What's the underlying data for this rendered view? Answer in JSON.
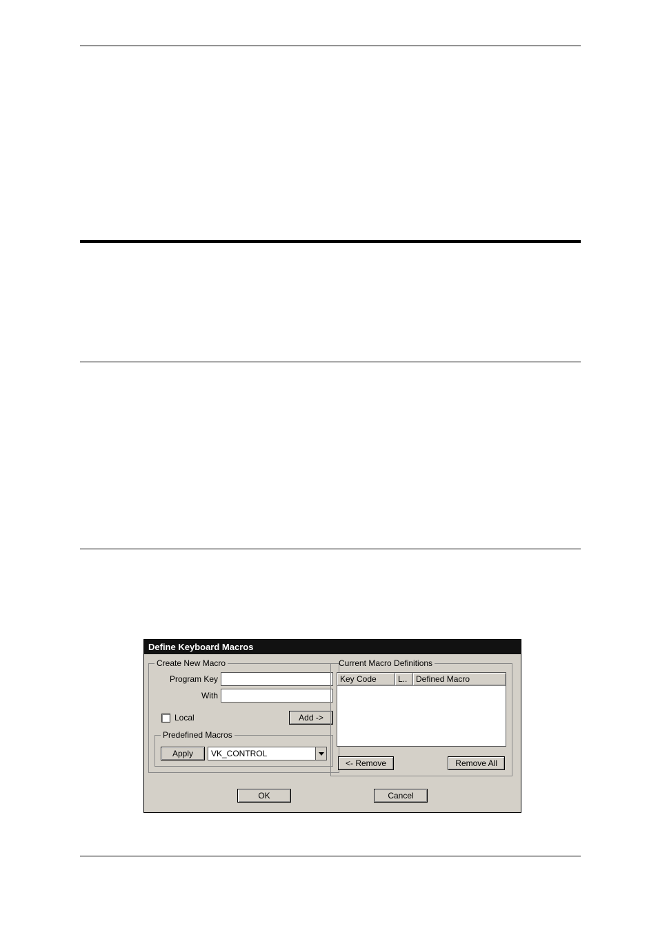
{
  "dialog": {
    "title": "Define Keyboard Macros",
    "create": {
      "legend": "Create New Macro",
      "program_key_label": "Program Key",
      "program_key_value": "",
      "with_label": "With",
      "with_value": "",
      "local_label": "Local",
      "add_label": "Add ->"
    },
    "predefined": {
      "legend": "Predefined Macros",
      "apply_label": "Apply",
      "selected": "VK_CONTROL"
    },
    "current": {
      "legend": "Current Macro Definitions",
      "columns": {
        "key_code": "Key Code",
        "local": "L..",
        "defined_macro": "Defined Macro"
      },
      "remove_label": "<- Remove",
      "remove_all_label": "Remove All"
    },
    "footer": {
      "ok_label": "OK",
      "cancel_label": "Cancel"
    }
  }
}
